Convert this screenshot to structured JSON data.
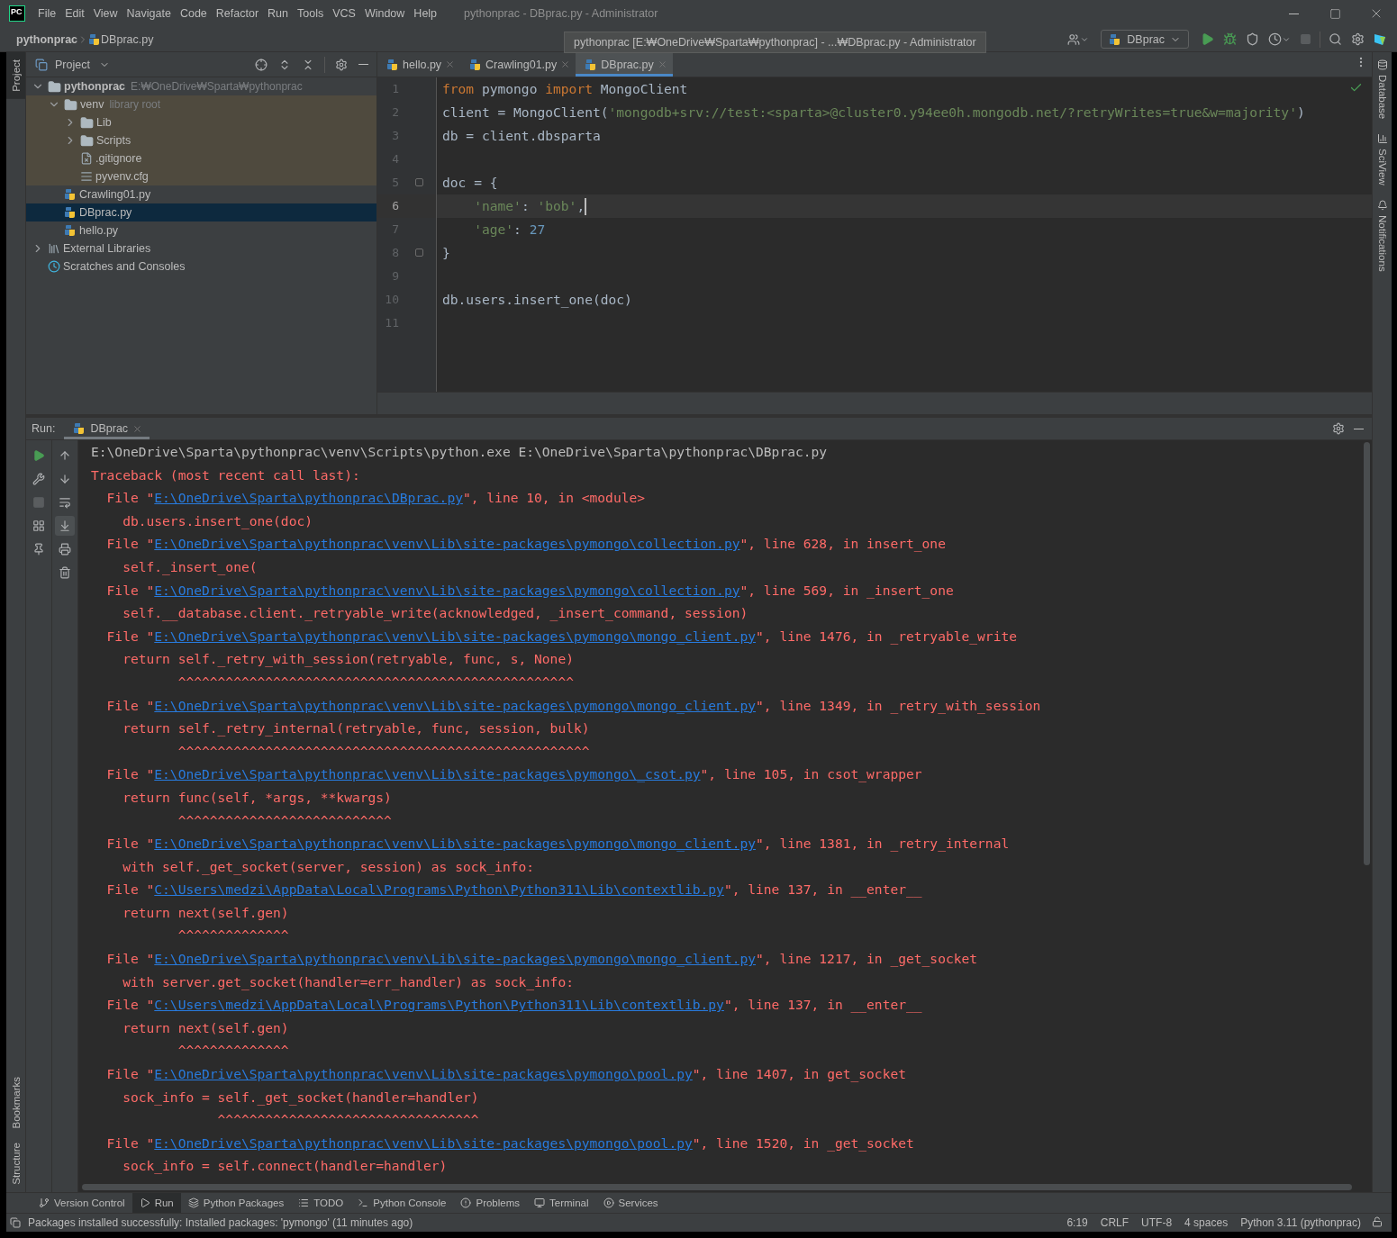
{
  "title_bar": {
    "logo": "PC",
    "menu": [
      "File",
      "Edit",
      "View",
      "Navigate",
      "Code",
      "Refactor",
      "Run",
      "Tools",
      "VCS",
      "Window",
      "Help"
    ],
    "title": "pythonprac - DBprac.py - Administrator"
  },
  "nav_bar": {
    "breadcrumb": [
      "pythonprac",
      "DBprac.py"
    ],
    "run_config": "DBprac"
  },
  "tooltip": "pythonprac [E:₩OneDrive₩Sparta₩pythonprac] - ...₩DBprac.py - Administrator",
  "left_stripe": {
    "top": [
      {
        "label": "Project",
        "selected": true
      }
    ],
    "bottom": [
      {
        "label": "Bookmarks",
        "selected": false
      },
      {
        "label": "Structure",
        "selected": false
      }
    ]
  },
  "right_stripe": [
    {
      "label": "Database",
      "kind": "database"
    },
    {
      "label": "SciView",
      "kind": "sciview"
    },
    {
      "label": "Notifications",
      "kind": "notifications"
    }
  ],
  "project": {
    "title": "Project",
    "tree": [
      {
        "label": "pythonprac",
        "kind": "folder",
        "hint": "E:₩OneDrive₩Sparta₩pythonprac",
        "expanded": true,
        "library": false,
        "selected": false,
        "children": [
          {
            "label": "venv",
            "kind": "folder",
            "hint": "library root",
            "expanded": true,
            "library": true,
            "selected": false,
            "children": [
              {
                "label": "Lib",
                "kind": "folder",
                "expanded": false,
                "library": true,
                "selected": false
              },
              {
                "label": "Scripts",
                "kind": "folder",
                "expanded": false,
                "library": true,
                "selected": false
              },
              {
                "label": ".gitignore",
                "kind": "ignore",
                "library": true,
                "selected": false
              },
              {
                "label": "pyvenv.cfg",
                "kind": "config",
                "library": true,
                "selected": false
              }
            ]
          },
          {
            "label": "Crawling01.py",
            "kind": "python",
            "library": false,
            "selected": false
          },
          {
            "label": "DBprac.py",
            "kind": "python",
            "library": false,
            "selected": true
          },
          {
            "label": "hello.py",
            "kind": "python",
            "library": false,
            "selected": false
          }
        ]
      },
      {
        "label": "External Libraries",
        "kind": "libraries",
        "expanded": false,
        "library": false,
        "selected": false
      },
      {
        "label": "Scratches and Consoles",
        "kind": "scratches",
        "library": false,
        "selected": false
      }
    ]
  },
  "editor": {
    "tabs": [
      {
        "label": "hello.py",
        "selected": false
      },
      {
        "label": "Crawling01.py",
        "selected": false
      },
      {
        "label": "DBprac.py",
        "selected": true
      }
    ],
    "lines": [
      {
        "number": "1",
        "current": false,
        "fold": false,
        "tokens": [
          {
            "kind": "keyword",
            "text": "from"
          },
          {
            "kind": "plain",
            "text": " pymongo "
          },
          {
            "kind": "keyword",
            "text": "import"
          },
          {
            "kind": "plain",
            "text": " MongoClient"
          }
        ]
      },
      {
        "number": "2",
        "current": false,
        "fold": false,
        "tokens": [
          {
            "kind": "plain",
            "text": "client = MongoClient("
          },
          {
            "kind": "string",
            "text": "'mongodb+srv://test:<sparta>@cluster0.y94ee0h.mongodb.net/?retryWrites=true&w=majority'"
          },
          {
            "kind": "plain",
            "text": ")"
          }
        ]
      },
      {
        "number": "3",
        "current": false,
        "fold": false,
        "tokens": [
          {
            "kind": "plain",
            "text": "db = client.dbsparta"
          }
        ]
      },
      {
        "number": "4",
        "current": false,
        "fold": false
      },
      {
        "number": "5",
        "current": false,
        "fold": true,
        "tokens": [
          {
            "kind": "plain",
            "text": "doc = {"
          }
        ]
      },
      {
        "number": "6",
        "current": true,
        "fold": false,
        "tokens": [
          {
            "kind": "string",
            "text": "    'name'"
          },
          {
            "kind": "plain",
            "text": ": "
          },
          {
            "kind": "string",
            "text": "'bob'"
          },
          {
            "kind": "plain",
            "text": ","
          }
        ]
      },
      {
        "number": "7",
        "current": false,
        "fold": false,
        "tokens": [
          {
            "kind": "string",
            "text": "    'age'"
          },
          {
            "kind": "plain",
            "text": ": "
          },
          {
            "kind": "number",
            "text": "27"
          }
        ]
      },
      {
        "number": "8",
        "current": false,
        "fold": true,
        "tokens": [
          {
            "kind": "plain",
            "text": "}"
          }
        ]
      },
      {
        "number": "9",
        "current": false,
        "fold": false
      },
      {
        "number": "10",
        "current": false,
        "fold": false,
        "tokens": [
          {
            "kind": "plain",
            "text": "db.users.insert_one(doc)"
          }
        ]
      },
      {
        "number": "11",
        "current": false,
        "fold": false
      }
    ]
  },
  "run": {
    "label": "Run:",
    "tab": "DBprac",
    "output": [
      {
        "kind": "command",
        "text": "E:\\OneDrive\\Sparta\\pythonprac\\venv\\Scripts\\python.exe E:\\OneDrive\\Sparta\\pythonprac\\DBprac.py"
      },
      {
        "kind": "error",
        "text": "Traceback (most recent call last):"
      },
      {
        "kind": "file",
        "prefix": "  File \"",
        "path": "E:\\OneDrive\\Sparta\\pythonprac\\DBprac.py",
        "suffix": "\", line 10, in <module>"
      },
      {
        "kind": "error",
        "text": "    db.users.insert_one(doc)"
      },
      {
        "kind": "file",
        "prefix": "  File \"",
        "path": "E:\\OneDrive\\Sparta\\pythonprac\\venv\\Lib\\site-packages\\pymongo\\collection.py",
        "suffix": "\", line 628, in insert_one"
      },
      {
        "kind": "error",
        "text": "    self._insert_one("
      },
      {
        "kind": "file",
        "prefix": "  File \"",
        "path": "E:\\OneDrive\\Sparta\\pythonprac\\venv\\Lib\\site-packages\\pymongo\\collection.py",
        "suffix": "\", line 569, in _insert_one"
      },
      {
        "kind": "error",
        "text": "    self.__database.client._retryable_write(acknowledged, _insert_command, session)"
      },
      {
        "kind": "file",
        "prefix": "  File \"",
        "path": "E:\\OneDrive\\Sparta\\pythonprac\\venv\\Lib\\site-packages\\pymongo\\mongo_client.py",
        "suffix": "\", line 1476, in _retryable_write"
      },
      {
        "kind": "error",
        "text": "    return self._retry_with_session(retryable, func, s, None)"
      },
      {
        "kind": "error",
        "text": "           ^^^^^^^^^^^^^^^^^^^^^^^^^^^^^^^^^^^^^^^^^^^^^^^^^^"
      },
      {
        "kind": "file",
        "prefix": "  File \"",
        "path": "E:\\OneDrive\\Sparta\\pythonprac\\venv\\Lib\\site-packages\\pymongo\\mongo_client.py",
        "suffix": "\", line 1349, in _retry_with_session"
      },
      {
        "kind": "error",
        "text": "    return self._retry_internal(retryable, func, session, bulk)"
      },
      {
        "kind": "error",
        "text": "           ^^^^^^^^^^^^^^^^^^^^^^^^^^^^^^^^^^^^^^^^^^^^^^^^^^^^"
      },
      {
        "kind": "file",
        "prefix": "  File \"",
        "path": "E:\\OneDrive\\Sparta\\pythonprac\\venv\\Lib\\site-packages\\pymongo\\_csot.py",
        "suffix": "\", line 105, in csot_wrapper"
      },
      {
        "kind": "error",
        "text": "    return func(self, *args, **kwargs)"
      },
      {
        "kind": "error",
        "text": "           ^^^^^^^^^^^^^^^^^^^^^^^^^^^"
      },
      {
        "kind": "file",
        "prefix": "  File \"",
        "path": "E:\\OneDrive\\Sparta\\pythonprac\\venv\\Lib\\site-packages\\pymongo\\mongo_client.py",
        "suffix": "\", line 1381, in _retry_internal"
      },
      {
        "kind": "error",
        "text": "    with self._get_socket(server, session) as sock_info:"
      },
      {
        "kind": "file",
        "prefix": "  File \"",
        "path": "C:\\Users\\medzi\\AppData\\Local\\Programs\\Python\\Python311\\Lib\\contextlib.py",
        "suffix": "\", line 137, in __enter__"
      },
      {
        "kind": "error",
        "text": "    return next(self.gen)"
      },
      {
        "kind": "error",
        "text": "           ^^^^^^^^^^^^^^"
      },
      {
        "kind": "file",
        "prefix": "  File \"",
        "path": "E:\\OneDrive\\Sparta\\pythonprac\\venv\\Lib\\site-packages\\pymongo\\mongo_client.py",
        "suffix": "\", line 1217, in _get_socket"
      },
      {
        "kind": "error",
        "text": "    with server.get_socket(handler=err_handler) as sock_info:"
      },
      {
        "kind": "file",
        "prefix": "  File \"",
        "path": "C:\\Users\\medzi\\AppData\\Local\\Programs\\Python\\Python311\\Lib\\contextlib.py",
        "suffix": "\", line 137, in __enter__"
      },
      {
        "kind": "error",
        "text": "    return next(self.gen)"
      },
      {
        "kind": "error",
        "text": "           ^^^^^^^^^^^^^^"
      },
      {
        "kind": "file",
        "prefix": "  File \"",
        "path": "E:\\OneDrive\\Sparta\\pythonprac\\venv\\Lib\\site-packages\\pymongo\\pool.py",
        "suffix": "\", line 1407, in get_socket"
      },
      {
        "kind": "error",
        "text": "    sock_info = self._get_socket(handler=handler)"
      },
      {
        "kind": "error",
        "text": "                ^^^^^^^^^^^^^^^^^^^^^^^^^^^^^^^^^"
      },
      {
        "kind": "file",
        "prefix": "  File \"",
        "path": "E:\\OneDrive\\Sparta\\pythonprac\\venv\\Lib\\site-packages\\pymongo\\pool.py",
        "suffix": "\", line 1520, in _get_socket"
      },
      {
        "kind": "error",
        "text": "    sock_info = self.connect(handler=handler)"
      }
    ]
  },
  "tool_windows": [
    {
      "label": "Version Control",
      "kind": "vcs",
      "selected": false
    },
    {
      "label": "Run",
      "kind": "run",
      "selected": true
    },
    {
      "label": "Python Packages",
      "kind": "packages",
      "selected": false
    },
    {
      "label": "TODO",
      "kind": "todo",
      "selected": false
    },
    {
      "label": "Python Console",
      "kind": "console",
      "selected": false
    },
    {
      "label": "Problems",
      "kind": "problems",
      "selected": false
    },
    {
      "label": "Terminal",
      "kind": "terminal",
      "selected": false
    },
    {
      "label": "Services",
      "kind": "services",
      "selected": false
    }
  ],
  "status_bar": {
    "message": "Packages installed successfully: Installed packages: 'pymongo' (11 minutes ago)",
    "items": [
      "6:19",
      "CRLF",
      "UTF-8",
      "4 spaces",
      "Python 3.11 (pythonprac)"
    ]
  }
}
